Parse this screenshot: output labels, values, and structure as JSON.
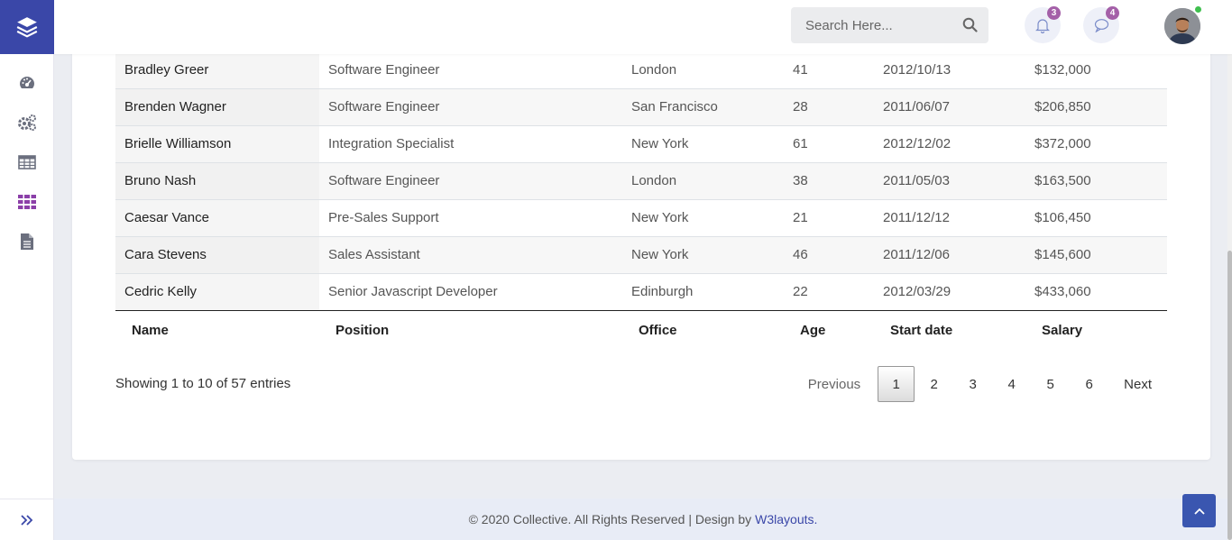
{
  "header": {
    "search_placeholder": "Search Here...",
    "notification_count": "3",
    "message_count": "4"
  },
  "sidebar": {
    "items": [
      {
        "icon": "dashboard-icon"
      },
      {
        "icon": "settings-icon"
      },
      {
        "icon": "table-icon"
      },
      {
        "icon": "grid-icon",
        "active": true
      },
      {
        "icon": "document-icon"
      }
    ],
    "expand_icon": "double-chevron-right-icon"
  },
  "table": {
    "rows": [
      {
        "name": "Bradley Greer",
        "position": "Software Engineer",
        "office": "London",
        "age": "41",
        "start_date": "2012/10/13",
        "salary": "$132,000"
      },
      {
        "name": "Brenden Wagner",
        "position": "Software Engineer",
        "office": "San Francisco",
        "age": "28",
        "start_date": "2011/06/07",
        "salary": "$206,850"
      },
      {
        "name": "Brielle Williamson",
        "position": "Integration Specialist",
        "office": "New York",
        "age": "61",
        "start_date": "2012/12/02",
        "salary": "$372,000"
      },
      {
        "name": "Bruno Nash",
        "position": "Software Engineer",
        "office": "London",
        "age": "38",
        "start_date": "2011/05/03",
        "salary": "$163,500"
      },
      {
        "name": "Caesar Vance",
        "position": "Pre-Sales Support",
        "office": "New York",
        "age": "21",
        "start_date": "2011/12/12",
        "salary": "$106,450"
      },
      {
        "name": "Cara Stevens",
        "position": "Sales Assistant",
        "office": "New York",
        "age": "46",
        "start_date": "2011/12/06",
        "salary": "$145,600"
      },
      {
        "name": "Cedric Kelly",
        "position": "Senior Javascript Developer",
        "office": "Edinburgh",
        "age": "22",
        "start_date": "2012/03/29",
        "salary": "$433,060"
      }
    ],
    "footer_headers": [
      "Name",
      "Position",
      "Office",
      "Age",
      "Start date",
      "Salary"
    ]
  },
  "pagination": {
    "info": "Showing 1 to 10 of 57 entries",
    "previous": "Previous",
    "pages": [
      "1",
      "2",
      "3",
      "4",
      "5",
      "6"
    ],
    "active_page": "1",
    "next": "Next"
  },
  "footer": {
    "text": "© 2020 Collective. All Rights Reserved | Design by",
    "link": "W3layouts."
  },
  "colors": {
    "brand": "#3a47a8",
    "badge": "#a460a8",
    "active_icon": "#8b3fa8"
  }
}
